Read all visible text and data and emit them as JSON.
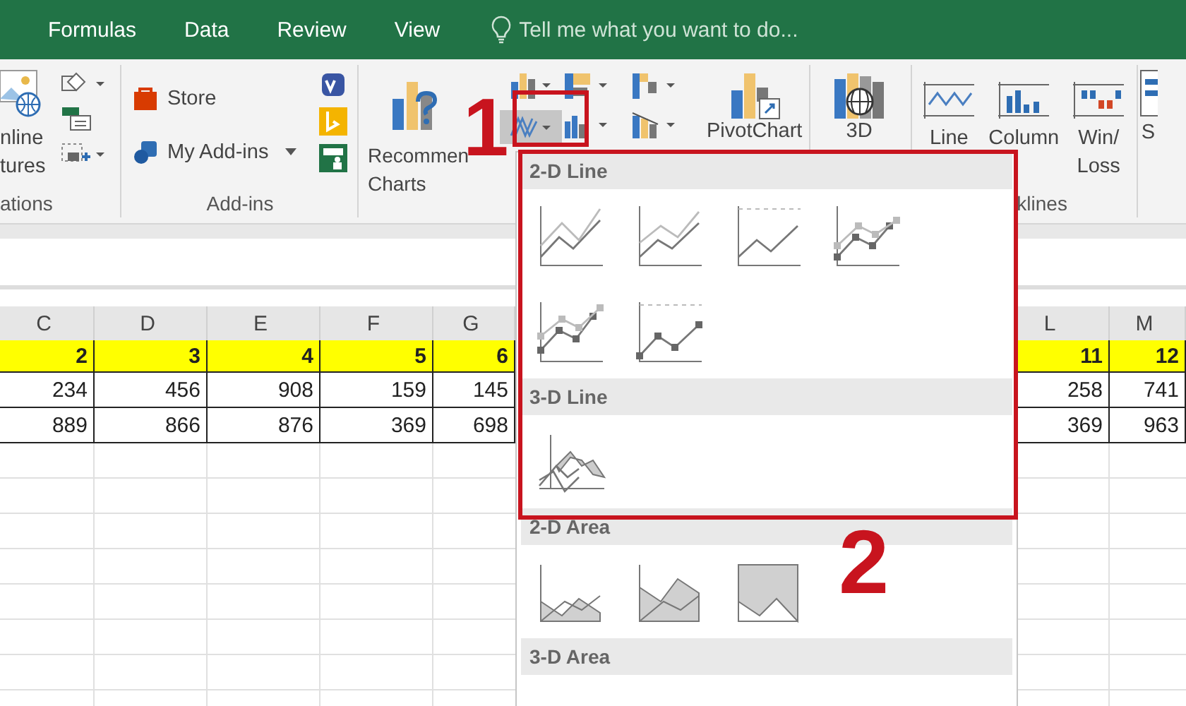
{
  "tabs": [
    {
      "label": "Formulas",
      "selected": false
    },
    {
      "label": "Data",
      "selected": false
    },
    {
      "label": "Review",
      "selected": false
    },
    {
      "label": "View",
      "selected": false
    }
  ],
  "tell_me": {
    "placeholder": "Tell me what you want to do..."
  },
  "ribbon": {
    "pictures_label": "nline\ntures",
    "illustrations_label": "ations",
    "store": "Store",
    "my_addins": "My Add-ins",
    "addins_label": "Add-ins",
    "recommended": "Recommen\nCharts",
    "line_button": {
      "pressed": true
    },
    "pivotchart": "PivotChart",
    "map3d": "3D",
    "sparklines": [
      {
        "label": "Line",
        "kind": "line"
      },
      {
        "label": "Column",
        "kind": "column"
      },
      {
        "label": "Win/\nLoss",
        "kind": "winloss"
      }
    ],
    "sparklines_label": "klines",
    "cut_label": "S"
  },
  "sheet": {
    "columns": [
      "C",
      "D",
      "E",
      "F",
      "G",
      "L",
      "M"
    ],
    "rows": [
      {
        "highlighted": true,
        "cells": [
          "2",
          "3",
          "4",
          "5",
          "6",
          "11",
          "12"
        ]
      },
      {
        "highlighted": false,
        "cells": [
          "234",
          "456",
          "908",
          "159",
          "145",
          "258",
          "741"
        ]
      },
      {
        "highlighted": false,
        "cells": [
          "889",
          "866",
          "876",
          "369",
          "698",
          "369",
          "963"
        ]
      }
    ]
  },
  "chart_menu": {
    "sections": [
      {
        "title": "2-D Line",
        "items": [
          {
            "kind": "line"
          },
          {
            "kind": "stacked-line"
          },
          {
            "kind": "percent-line"
          },
          {
            "kind": "line-markers"
          },
          {
            "kind": "stacked-markers"
          },
          {
            "kind": "percent-markers"
          }
        ]
      },
      {
        "title": "3-D Line",
        "items": [
          {
            "kind": "line-3d"
          }
        ]
      },
      {
        "title": "2-D Area",
        "items": [
          {
            "kind": "area"
          },
          {
            "kind": "stacked-area"
          },
          {
            "kind": "percent-area"
          }
        ]
      },
      {
        "title": "3-D Area"
      }
    ]
  },
  "annotations": [
    {
      "label": "1"
    },
    {
      "label": "2"
    }
  ]
}
